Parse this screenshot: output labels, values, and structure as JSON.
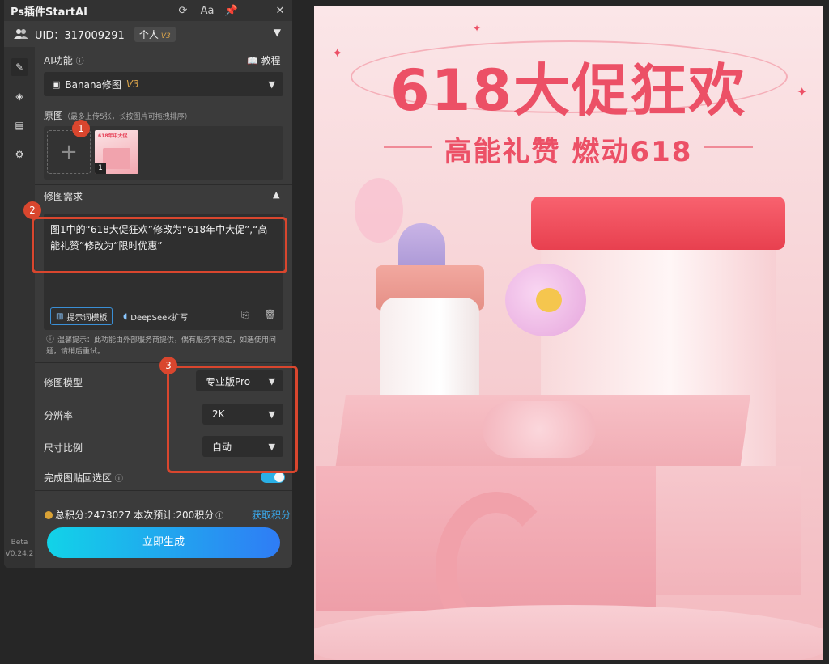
{
  "app": {
    "title": "Ps插件StartAI",
    "window_buttons": [
      "⟳",
      "Aa",
      "📌",
      "—",
      "✕"
    ]
  },
  "user": {
    "uid_label": "UID：317009291",
    "plan": "个人",
    "plan_version": "V3"
  },
  "ai_function": {
    "label": "AI功能",
    "tutorial": "教程",
    "selected": "Banana修图",
    "selected_version": "V3"
  },
  "original": {
    "label": "原图",
    "hint": "（最多上传5张，长按图片可拖拽排序）",
    "thumb_index": "1",
    "thumb_text": "618年中大促"
  },
  "request": {
    "label": "修图需求",
    "text": "图1中的“618大促狂欢”修改为“618年中大促”,“高能礼赞”修改为“限时优惠”",
    "template_btn": "提示词模板",
    "deepseek_btn": "DeepSeek扩写"
  },
  "warning": "温馨提示：此功能由外部服务商提供，偶有服务不稳定，如遇使用问题，请稍后重试。",
  "settings": {
    "model_label": "修图模型",
    "model_value": "专业版Pro",
    "resolution_label": "分辨率",
    "resolution_value": "2K",
    "ratio_label": "尺寸比例",
    "ratio_value": "自动",
    "paste_label": "完成图贴回选区",
    "paste_enabled": true
  },
  "credits": {
    "text": "总积分:2473027  本次预计:200积分",
    "get": "获取积分"
  },
  "generate": "立即生成",
  "version": {
    "beta": "Beta",
    "number": "V0.24.2"
  },
  "annotations": [
    "1",
    "2",
    "3"
  ],
  "poster": {
    "title": "618大促狂欢",
    "subtitle": "高能礼赞 燃动618"
  },
  "colors": {
    "accent_red": "#d9462e",
    "poster_red": "#ec5066",
    "link_blue": "#3aa7e8"
  }
}
